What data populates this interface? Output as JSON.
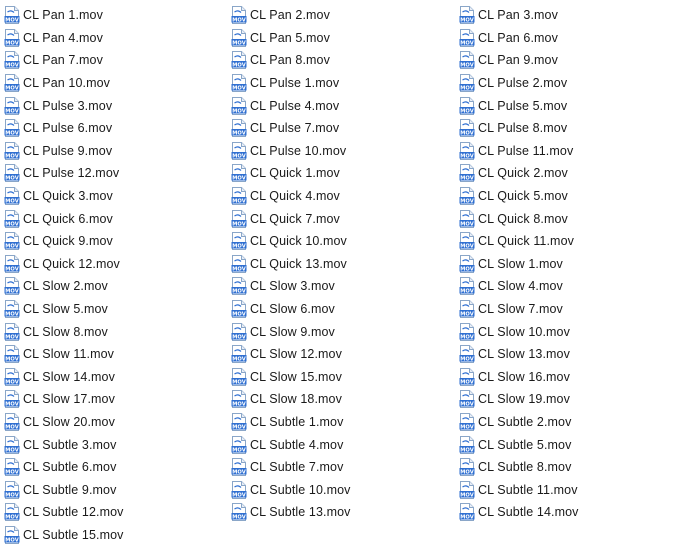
{
  "explorer": {
    "icon_name": "mov-file-icon",
    "icon_badge": "MOV",
    "files": [
      "CL Pan 1.mov",
      "CL Pan 2.mov",
      "CL Pan 3.mov",
      "CL Pan 4.mov",
      "CL Pan 5.mov",
      "CL Pan 6.mov",
      "CL Pan 7.mov",
      "CL Pan 8.mov",
      "CL Pan 9.mov",
      "CL Pan 10.mov",
      "CL Pulse 1.mov",
      "CL Pulse 2.mov",
      "CL Pulse 3.mov",
      "CL Pulse 4.mov",
      "CL Pulse 5.mov",
      "CL Pulse 6.mov",
      "CL Pulse 7.mov",
      "CL Pulse 8.mov",
      "CL Pulse 9.mov",
      "CL Pulse 10.mov",
      "CL Pulse 11.mov",
      "CL Pulse 12.mov",
      "CL Quick 1.mov",
      "CL Quick 2.mov",
      "CL Quick 3.mov",
      "CL Quick 4.mov",
      "CL Quick 5.mov",
      "CL Quick 6.mov",
      "CL Quick 7.mov",
      "CL Quick 8.mov",
      "CL Quick 9.mov",
      "CL Quick 10.mov",
      "CL Quick 11.mov",
      "CL Quick 12.mov",
      "CL Quick 13.mov",
      "CL Slow 1.mov",
      "CL Slow 2.mov",
      "CL Slow 3.mov",
      "CL Slow 4.mov",
      "CL Slow 5.mov",
      "CL Slow 6.mov",
      "CL Slow 7.mov",
      "CL Slow 8.mov",
      "CL Slow 9.mov",
      "CL Slow 10.mov",
      "CL Slow 11.mov",
      "CL Slow 12.mov",
      "CL Slow 13.mov",
      "CL Slow 14.mov",
      "CL Slow 15.mov",
      "CL Slow 16.mov",
      "CL Slow 17.mov",
      "CL Slow 18.mov",
      "CL Slow 19.mov",
      "CL Slow 20.mov",
      "CL Subtle 1.mov",
      "CL Subtle 2.mov",
      "CL Subtle 3.mov",
      "CL Subtle 4.mov",
      "CL Subtle 5.mov",
      "CL Subtle 6.mov",
      "CL Subtle 7.mov",
      "CL Subtle 8.mov",
      "CL Subtle 9.mov",
      "CL Subtle 10.mov",
      "CL Subtle 11.mov",
      "CL Subtle 12.mov",
      "CL Subtle 13.mov",
      "CL Subtle 14.mov",
      "CL Subtle 15.mov"
    ]
  },
  "colors": {
    "icon_blue": "#2f6fd1",
    "icon_page": "#ffffff",
    "icon_border": "#8aa6c8",
    "text": "#1a1a1a",
    "background": "#ffffff"
  }
}
